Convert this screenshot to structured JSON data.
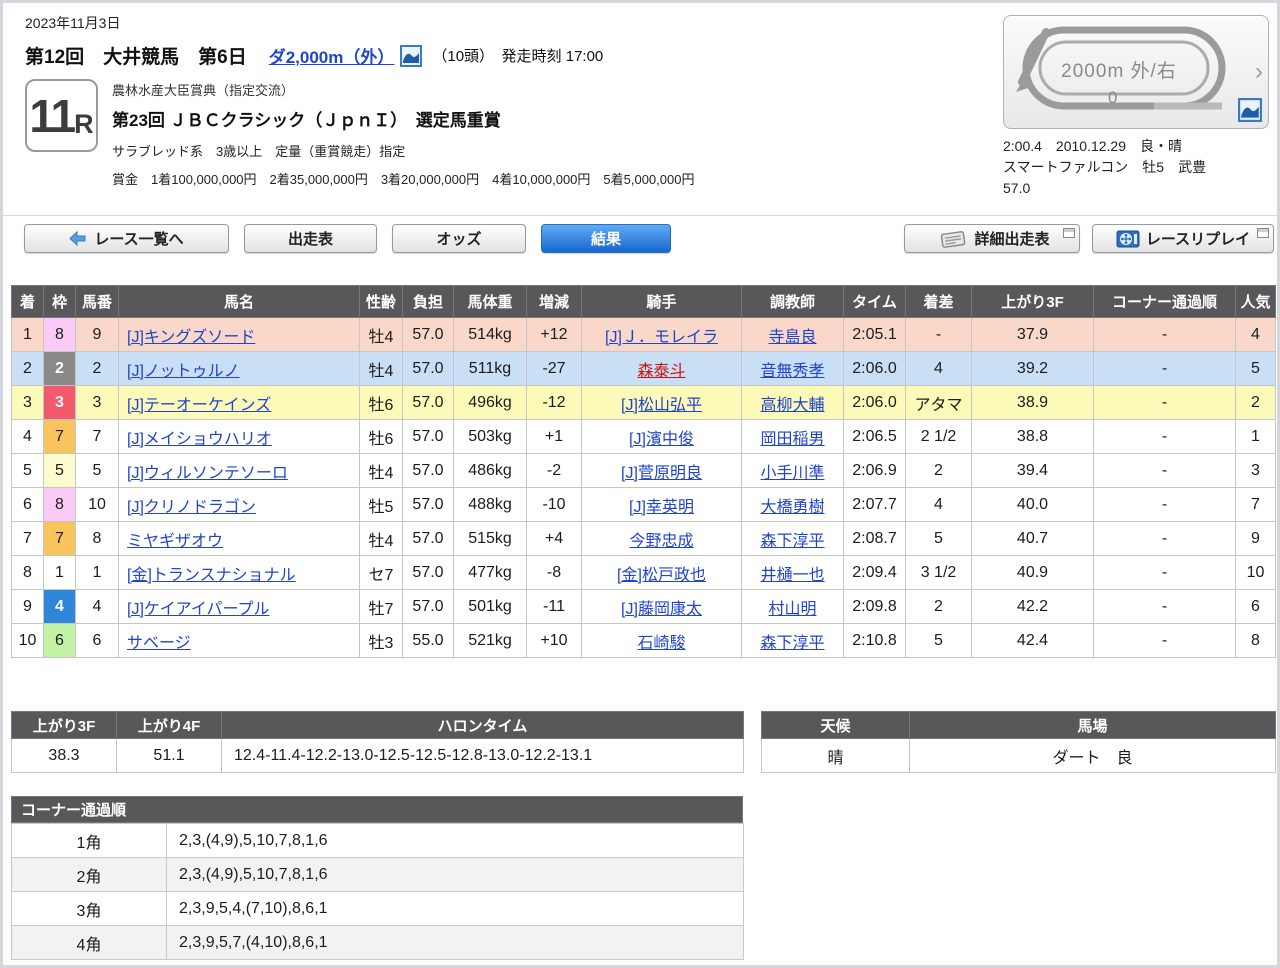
{
  "page": {
    "date": "2023年11月3日"
  },
  "header": {
    "meeting": "第12回　大井競馬　第6日",
    "course_link": "ダ2,000m（外）",
    "field_info": "（10頭）　発走時刻 17:00",
    "race_number": "11",
    "race_number_suffix": "R",
    "grade_line": "農林水産大臣賞典（指定交流）",
    "race_title": "第23回 ＪＢＣクラシック（ＪｐｎＩ）　選定馬重賞",
    "conditions": "サラブレッド系　3歳以上　定量（重賞競走）指定",
    "prize": "賞金　1着100,000,000円　2着35,000,000円　3着20,000,000円　4着10,000,000円　5着5,000,000円"
  },
  "course_widget": {
    "label": "2000m 外/右",
    "sub_label": "0",
    "chevron": "›",
    "record_line1": "2:00.4　2010.12.29　良・晴",
    "record_line2": "スマートファルコン　牡5　武豊",
    "record_line3": "57.0"
  },
  "nav": {
    "back": "レース一覧へ",
    "entries": "出走表",
    "odds": "オッズ",
    "results": "結果",
    "detail": "詳細出走表",
    "replay": "レースリプレイ"
  },
  "icons": {
    "back": "arrow-left-icon",
    "course": "course-view-icon",
    "detail": "newspaper-icon",
    "replay": "film-reel-icon",
    "popout": "new-window-icon"
  },
  "colors": {
    "link": "#2244cc",
    "link_red": "#cc1111",
    "table_header_bg": "#58585a",
    "active_tab_bg": "#1767ce"
  },
  "row_colors": {
    "1": "#f9d7c9",
    "2": "#c8dff6",
    "3": "#fbfab9"
  },
  "waku_colors": {
    "1": {
      "bg": "#ffffff",
      "fg": "#1c1c1c"
    },
    "2": {
      "bg": "#898989",
      "fg": "#ffffff"
    },
    "3": {
      "bg": "#f2596b",
      "fg": "#ffffff"
    },
    "4": {
      "bg": "#2e86d8",
      "fg": "#ffffff"
    },
    "5": {
      "bg": "#fcfbce",
      "fg": "#1c1c1c"
    },
    "6": {
      "bg": "#c3f2a5",
      "fg": "#1c1c1c"
    },
    "7": {
      "bg": "#f9c35e",
      "fg": "#1c1c1c"
    },
    "8": {
      "bg": "#f9cbf6",
      "fg": "#1c1c1c"
    }
  },
  "results": {
    "headers": [
      "着",
      "枠",
      "馬番",
      "馬名",
      "性齢",
      "負担",
      "馬体重",
      "増減",
      "騎手",
      "調教師",
      "タイム",
      "着差",
      "上がり3F",
      "コーナー通過順",
      "人気"
    ],
    "rows": [
      {
        "pos": "1",
        "waku": "8",
        "num": "9",
        "horse": "[J]キングズソード",
        "sexage": "牡4",
        "load": "57.0",
        "weight": "514kg",
        "diff": "+12",
        "jockey": "[J]Ｊ．モレイラ",
        "trainer": "寺島良",
        "time": "2:05.1",
        "margin": "-",
        "last3f": "37.9",
        "corner": "-",
        "pop": "4"
      },
      {
        "pos": "2",
        "waku": "2",
        "num": "2",
        "horse": "[J]ノットゥルノ",
        "sexage": "牡4",
        "load": "57.0",
        "weight": "511kg",
        "diff": "-27",
        "jockey": "森泰斗",
        "jockey_red": true,
        "trainer": "音無秀孝",
        "time": "2:06.0",
        "margin": "4",
        "last3f": "39.2",
        "corner": "-",
        "pop": "5"
      },
      {
        "pos": "3",
        "waku": "3",
        "num": "3",
        "horse": "[J]テーオーケインズ",
        "sexage": "牡6",
        "load": "57.0",
        "weight": "496kg",
        "diff": "-12",
        "jockey": "[J]松山弘平",
        "trainer": "高柳大輔",
        "time": "2:06.0",
        "margin": "アタマ",
        "last3f": "38.9",
        "corner": "-",
        "pop": "2"
      },
      {
        "pos": "4",
        "waku": "7",
        "num": "7",
        "horse": "[J]メイショウハリオ",
        "sexage": "牡6",
        "load": "57.0",
        "weight": "503kg",
        "diff": "+1",
        "jockey": "[J]濱中俊",
        "trainer": "岡田稲男",
        "time": "2:06.5",
        "margin": "2 1/2",
        "last3f": "38.8",
        "corner": "-",
        "pop": "1"
      },
      {
        "pos": "5",
        "waku": "5",
        "num": "5",
        "horse": "[J]ウィルソンテソーロ",
        "sexage": "牡4",
        "load": "57.0",
        "weight": "486kg",
        "diff": "-2",
        "jockey": "[J]菅原明良",
        "trainer": "小手川準",
        "time": "2:06.9",
        "margin": "2",
        "last3f": "39.4",
        "corner": "-",
        "pop": "3"
      },
      {
        "pos": "6",
        "waku": "8",
        "num": "10",
        "horse": "[J]クリノドラゴン",
        "sexage": "牡5",
        "load": "57.0",
        "weight": "488kg",
        "diff": "-10",
        "jockey": "[J]幸英明",
        "trainer": "大橋勇樹",
        "time": "2:07.7",
        "margin": "4",
        "last3f": "40.0",
        "corner": "-",
        "pop": "7"
      },
      {
        "pos": "7",
        "waku": "7",
        "num": "8",
        "horse": "ミヤギザオウ",
        "sexage": "牡4",
        "load": "57.0",
        "weight": "515kg",
        "diff": "+4",
        "jockey": "今野忠成",
        "trainer": "森下淳平",
        "time": "2:08.7",
        "margin": "5",
        "last3f": "40.7",
        "corner": "-",
        "pop": "9"
      },
      {
        "pos": "8",
        "waku": "1",
        "num": "1",
        "horse": "[金]トランスナショナル",
        "sexage": "セ7",
        "load": "57.0",
        "weight": "477kg",
        "diff": "-8",
        "jockey": "[金]松戸政也",
        "trainer": "井樋一也",
        "time": "2:09.4",
        "margin": "3 1/2",
        "last3f": "40.9",
        "corner": "-",
        "pop": "10"
      },
      {
        "pos": "9",
        "waku": "4",
        "num": "4",
        "horse": "[J]ケイアイパープル",
        "sexage": "牡7",
        "load": "57.0",
        "weight": "501kg",
        "diff": "-11",
        "jockey": "[J]藤岡康太",
        "trainer": "村山明",
        "time": "2:09.8",
        "margin": "2",
        "last3f": "42.2",
        "corner": "-",
        "pop": "6"
      },
      {
        "pos": "10",
        "waku": "6",
        "num": "6",
        "horse": "サベージ",
        "sexage": "牡3",
        "load": "55.0",
        "weight": "521kg",
        "diff": "+10",
        "jockey": "石崎駿",
        "trainer": "森下淳平",
        "time": "2:10.8",
        "margin": "5",
        "last3f": "42.4",
        "corner": "-",
        "pop": "8"
      }
    ]
  },
  "pace": {
    "headers": [
      "上がり3F",
      "上がり4F",
      "ハロンタイム"
    ],
    "last3f": "38.3",
    "last4f": "51.1",
    "furlong_times": "12.4-11.4-12.2-13.0-12.5-12.5-12.8-13.0-12.2-13.1"
  },
  "conditions_table": {
    "headers": [
      "天候",
      "馬場"
    ],
    "weather": "晴",
    "track": "ダート　良"
  },
  "corner": {
    "title": "コーナー通過順",
    "rows": [
      {
        "label": "1角",
        "value": "2,3,(4,9),5,10,7,8,1,6"
      },
      {
        "label": "2角",
        "value": "2,3,(4,9),5,10,7,8,1,6"
      },
      {
        "label": "3角",
        "value": "2,3,9,5,4,(7,10),8,6,1"
      },
      {
        "label": "4角",
        "value": "2,3,9,5,7,(4,10),8,6,1"
      }
    ]
  }
}
